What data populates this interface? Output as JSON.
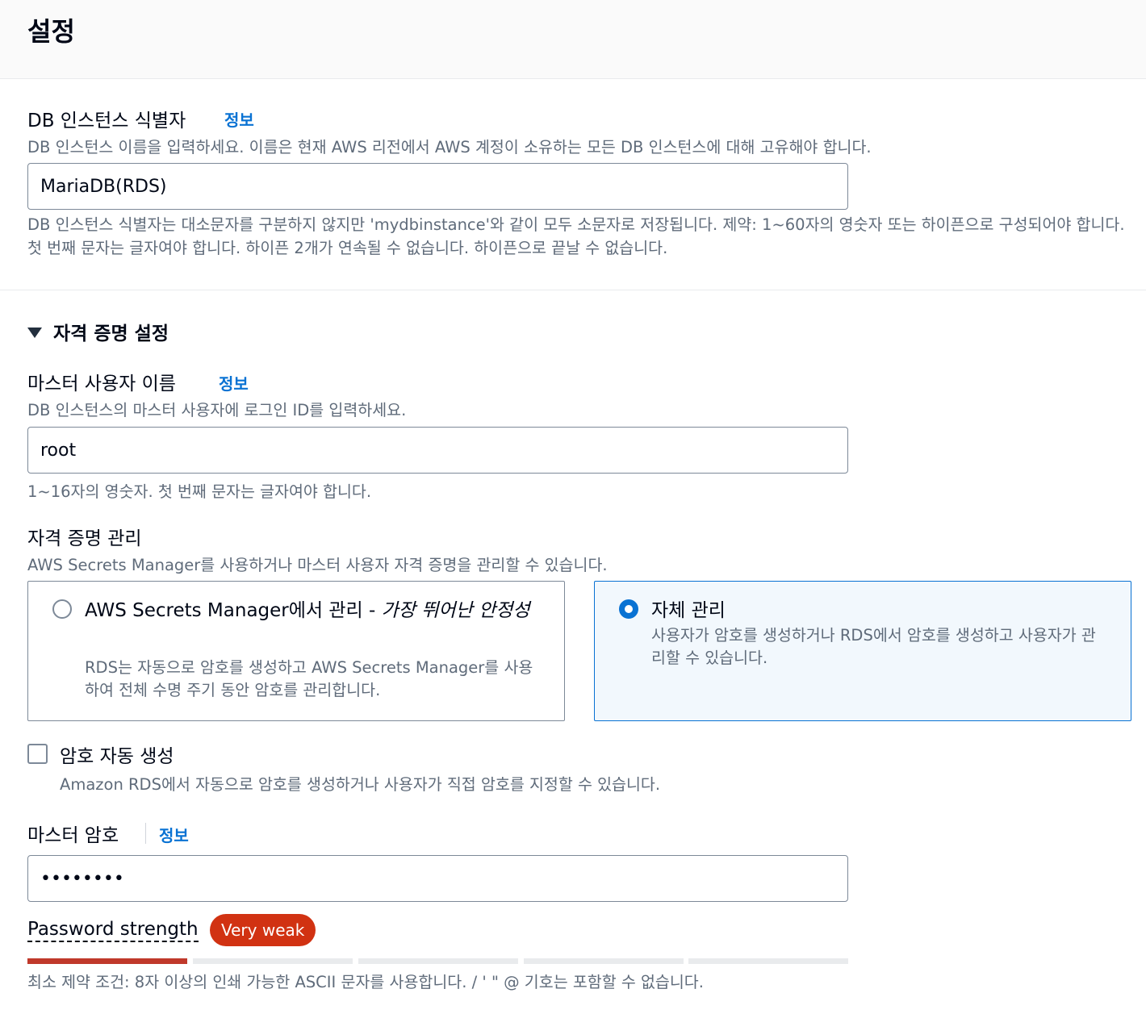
{
  "header": {
    "title": "설정"
  },
  "db_identifier": {
    "label": "DB 인스턴스 식별자",
    "info": "정보",
    "description": "DB 인스턴스 이름을 입력하세요. 이름은 현재 AWS 리전에서 AWS 계정이 소유하는 모든 DB 인스턴스에 대해 고유해야 합니다.",
    "value": "MariaDB(RDS)",
    "constraint": "DB 인스턴스 식별자는 대소문자를 구분하지 않지만 'mydbinstance'와 같이 모두 소문자로 저장됩니다. 제약: 1~60자의 영숫자 또는 하이픈으로 구성되어야 합니다. 첫 번째 문자는 글자여야 합니다. 하이픈 2개가 연속될 수 없습니다. 하이픈으로 끝날 수 없습니다."
  },
  "credentials": {
    "section_title": "자격 증명 설정",
    "master_username": {
      "label": "마스터 사용자 이름",
      "info": "정보",
      "description": "DB 인스턴스의 마스터 사용자에 로그인 ID를 입력하세요.",
      "value": "root",
      "constraint": "1~16자의 영숫자. 첫 번째 문자는 글자여야 합니다."
    },
    "management": {
      "label": "자격 증명 관리",
      "description": "AWS Secrets Manager를 사용하거나 마스터 사용자 자격 증명을 관리할 수 있습니다.",
      "options": [
        {
          "title": "AWS Secrets Manager에서 관리 -",
          "title_emphasis": "가장 뛰어난 안정성",
          "description": "RDS는 자동으로 암호를 생성하고 AWS Secrets Manager를 사용하여 전체 수명 주기 동안 암호를 관리합니다.",
          "selected": false
        },
        {
          "title": "자체 관리",
          "description": "사용자가 암호를 생성하거나 RDS에서 암호를 생성하고 사용자가 관리할 수 있습니다.",
          "selected": true
        }
      ]
    },
    "auto_generate": {
      "label": "암호 자동 생성",
      "description": "Amazon RDS에서 자동으로 암호를 생성하거나 사용자가 직접 암호를 지정할 수 있습니다.",
      "checked": false
    },
    "master_password": {
      "label": "마스터 암호",
      "info": "정보",
      "value": "rootpass",
      "strength_label": "Password strength",
      "strength_value": "Very weak",
      "strength_segments_filled": 1,
      "strength_segments_total": 5,
      "constraint": "최소 제약 조건: 8자 이상의 인쇄 가능한 ASCII 문자를 사용합니다. / ' \" @ 기호는 포함할 수 없습니다."
    }
  },
  "colors": {
    "accent": "#0972d3",
    "weak": "#d13212"
  }
}
